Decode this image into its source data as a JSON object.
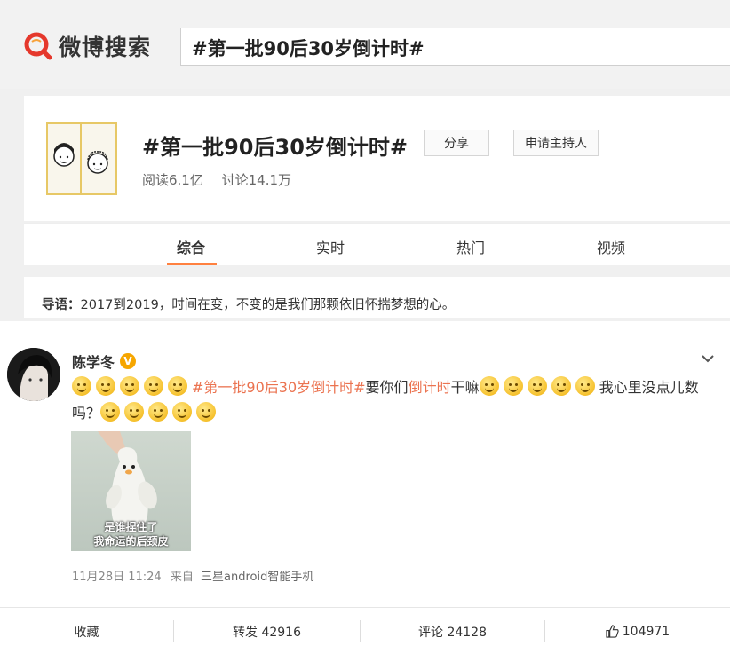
{
  "header": {
    "logo_text": "微博搜索",
    "search_query": "#第一批90后30岁倒计时#"
  },
  "topic": {
    "title": "#第一批90后30岁倒计时#",
    "share_label": "分享",
    "host_label": "申请主持人",
    "reads": "阅读6.1亿",
    "discussions": "讨论14.1万"
  },
  "tabs": [
    {
      "label": "综合",
      "active": true
    },
    {
      "label": "实时",
      "active": false
    },
    {
      "label": "热门",
      "active": false
    },
    {
      "label": "视频",
      "active": false
    }
  ],
  "intro": {
    "label": "导语：",
    "text": "2017到2019，时间在变，不变的是我们那颗依旧怀揣梦想的心。"
  },
  "post": {
    "author": "陈学冬",
    "verified_badge": "V",
    "content": {
      "hashtag": "#第一批90后30岁倒计时#",
      "text_1": "要你们",
      "highlight": "倒计时",
      "text_2": "干嘛",
      "text_3": "我心里没点儿数吗？"
    },
    "image_caption_line1": "是谁捏住了",
    "image_caption_line2": "我命运的后颈皮",
    "date": "11月28日 11:24",
    "source_prefix": "来自",
    "device": "三星android智能手机"
  },
  "actions": {
    "favorite": "收藏",
    "repost": "转发 42916",
    "comment": "评论 24128",
    "like": "104971"
  },
  "colors": {
    "accent": "#ff8140",
    "tag": "#eb7350",
    "logo_red": "#e5382c"
  }
}
